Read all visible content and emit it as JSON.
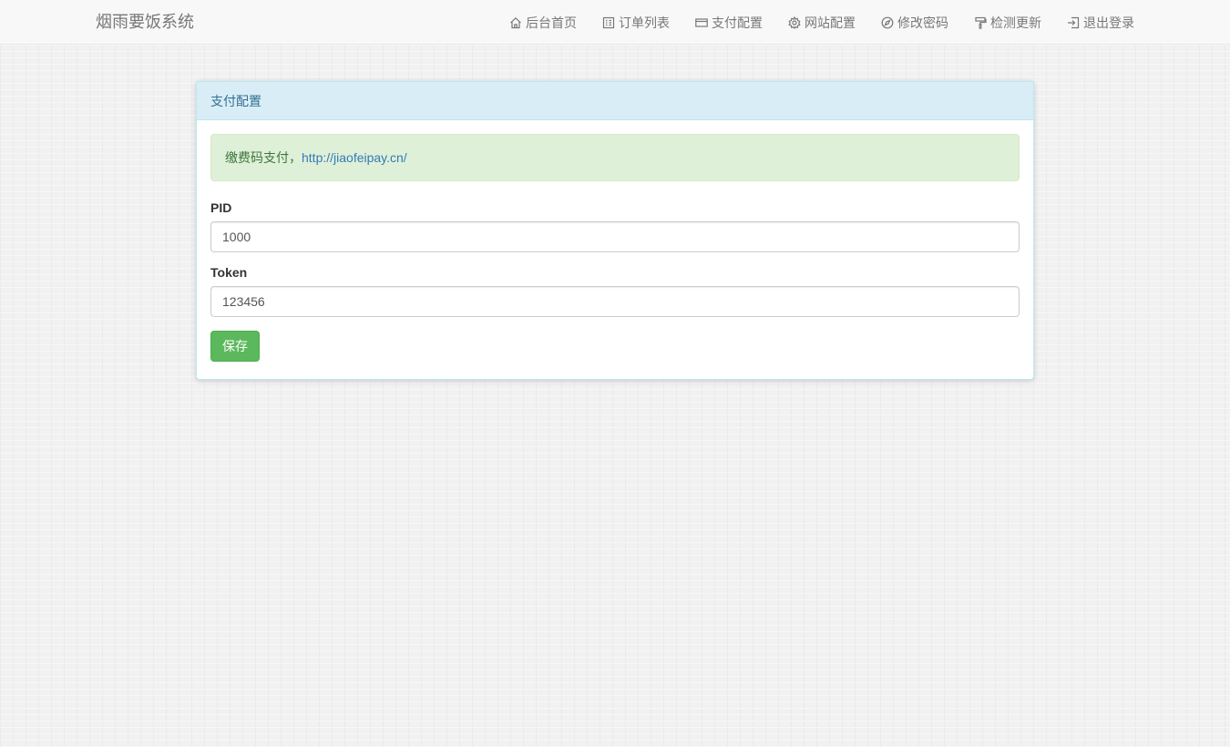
{
  "navbar": {
    "brand": "烟雨要饭系统",
    "items": [
      {
        "label": "后台首页",
        "icon": "home-icon"
      },
      {
        "label": "订单列表",
        "icon": "list-icon"
      },
      {
        "label": "支付配置",
        "icon": "credit-card-icon"
      },
      {
        "label": "网站配置",
        "icon": "gear-icon"
      },
      {
        "label": "修改密码",
        "icon": "compass-icon"
      },
      {
        "label": "检测更新",
        "icon": "paint-roller-icon"
      },
      {
        "label": "退出登录",
        "icon": "log-out-icon"
      }
    ]
  },
  "panel": {
    "title": "支付配置",
    "alert": {
      "text": "缴费码支付，",
      "link": "http://jiaofeipay.cn/"
    },
    "fields": {
      "pid": {
        "label": "PID",
        "value": "1000"
      },
      "token": {
        "label": "Token",
        "value": "123456"
      }
    },
    "save_label": "保存"
  },
  "colors": {
    "panel_heading_bg": "#d9edf7",
    "panel_heading_text": "#31708f",
    "alert_bg": "#dff0d8",
    "alert_text": "#3c763d",
    "link": "#337ab7",
    "save_button": "#5cb85c"
  }
}
